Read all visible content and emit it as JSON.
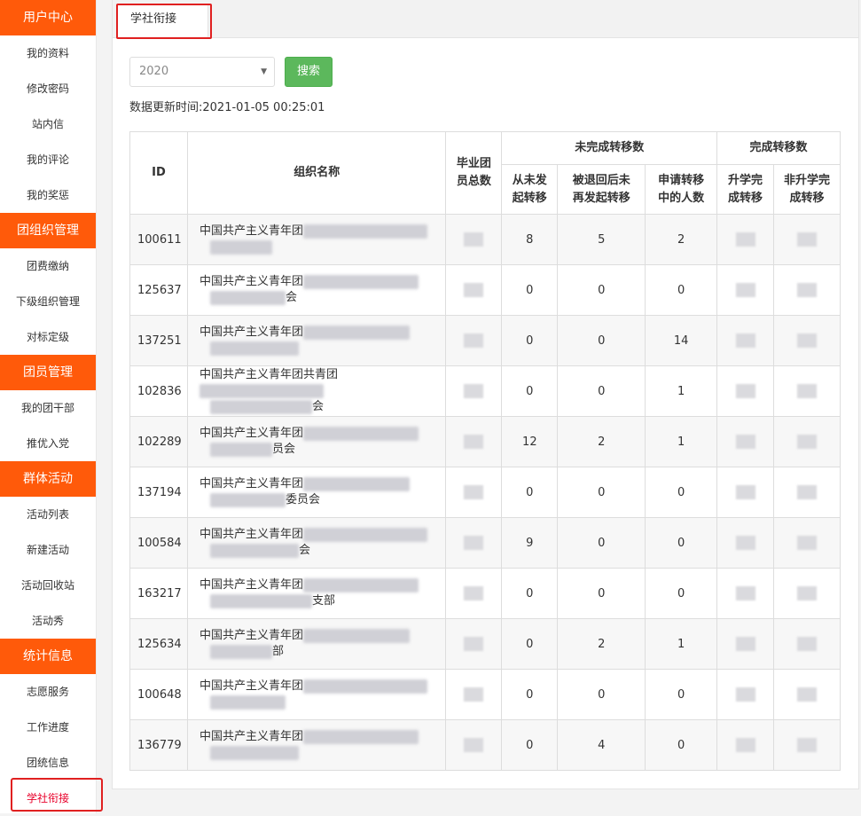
{
  "sidebar": {
    "sections": [
      {
        "title": "用户中心",
        "items": [
          "我的资料",
          "修改密码",
          "站内信",
          "我的评论",
          "我的奖惩"
        ]
      },
      {
        "title": "团组织管理",
        "items": [
          "团费缴纳",
          "下级组织管理",
          "对标定级"
        ]
      },
      {
        "title": "团员管理",
        "items": [
          "我的团干部",
          "推优入党"
        ]
      },
      {
        "title": "群体活动",
        "items": [
          "活动列表",
          "新建活动",
          "活动回收站",
          "活动秀"
        ]
      },
      {
        "title": "统计信息",
        "items": [
          "志愿服务",
          "工作进度",
          "团统信息",
          "学社衔接"
        ]
      }
    ]
  },
  "tab": {
    "label": "学社衔接"
  },
  "filter": {
    "year": "2020",
    "search_label": "搜索"
  },
  "update_time": "数据更新时间:2021-01-05 00:25:01",
  "table": {
    "headers": {
      "id": "ID",
      "org": "组织名称",
      "total": "毕业团员总数",
      "incomplete_group": "未完成转移数",
      "not_started": "从未发起转移",
      "returned": "被退回后未再发起转移",
      "applying": "申请转移中的人数",
      "complete_group": "完成转移数",
      "school": "升学完成转移",
      "non_school": "非升学完成转移"
    },
    "rows": [
      {
        "id": "100611",
        "org1": "中国共产主义青年团",
        "org2": "",
        "not_started": "8",
        "returned": "5",
        "applying": "2"
      },
      {
        "id": "125637",
        "org1": "中国共产主义青年团",
        "org2": "科",
        "org2b": "会",
        "not_started": "0",
        "returned": "0",
        "applying": "0"
      },
      {
        "id": "137251",
        "org1": "中国共产主义青年团",
        "org2": "",
        "not_started": "0",
        "returned": "0",
        "applying": "14"
      },
      {
        "id": "102836",
        "org1": "中国共产主义青年团共青团",
        "org2": "学",
        "org2b": "会",
        "not_started": "0",
        "returned": "0",
        "applying": "1"
      },
      {
        "id": "102289",
        "org1": "中国共产主义青年团",
        "org2": "机",
        "org2b": "员会",
        "not_started": "12",
        "returned": "2",
        "applying": "1"
      },
      {
        "id": "137194",
        "org1": "中国共产主义青年团",
        "org2": "",
        "org2b": "委员会",
        "not_started": "0",
        "returned": "0",
        "applying": "0"
      },
      {
        "id": "100584",
        "org1": "中国共产主义青年团",
        "org2": "",
        "org2b": "会",
        "not_started": "9",
        "returned": "0",
        "applying": "0"
      },
      {
        "id": "163217",
        "org1": "中国共产主义青年团",
        "org2": "",
        "org2b": "支部",
        "not_started": "0",
        "returned": "0",
        "applying": "0"
      },
      {
        "id": "125634",
        "org1": "中国共产主义青年团",
        "org2": "",
        "org2b": "部",
        "not_started": "0",
        "returned": "2",
        "applying": "1"
      },
      {
        "id": "100648",
        "org1": "中国共产主义青年团",
        "org2": "",
        "not_started": "0",
        "returned": "0",
        "applying": "0"
      },
      {
        "id": "136779",
        "org1": "中国共产主义青年团",
        "org2": "",
        "not_started": "0",
        "returned": "4",
        "applying": "0"
      }
    ]
  }
}
